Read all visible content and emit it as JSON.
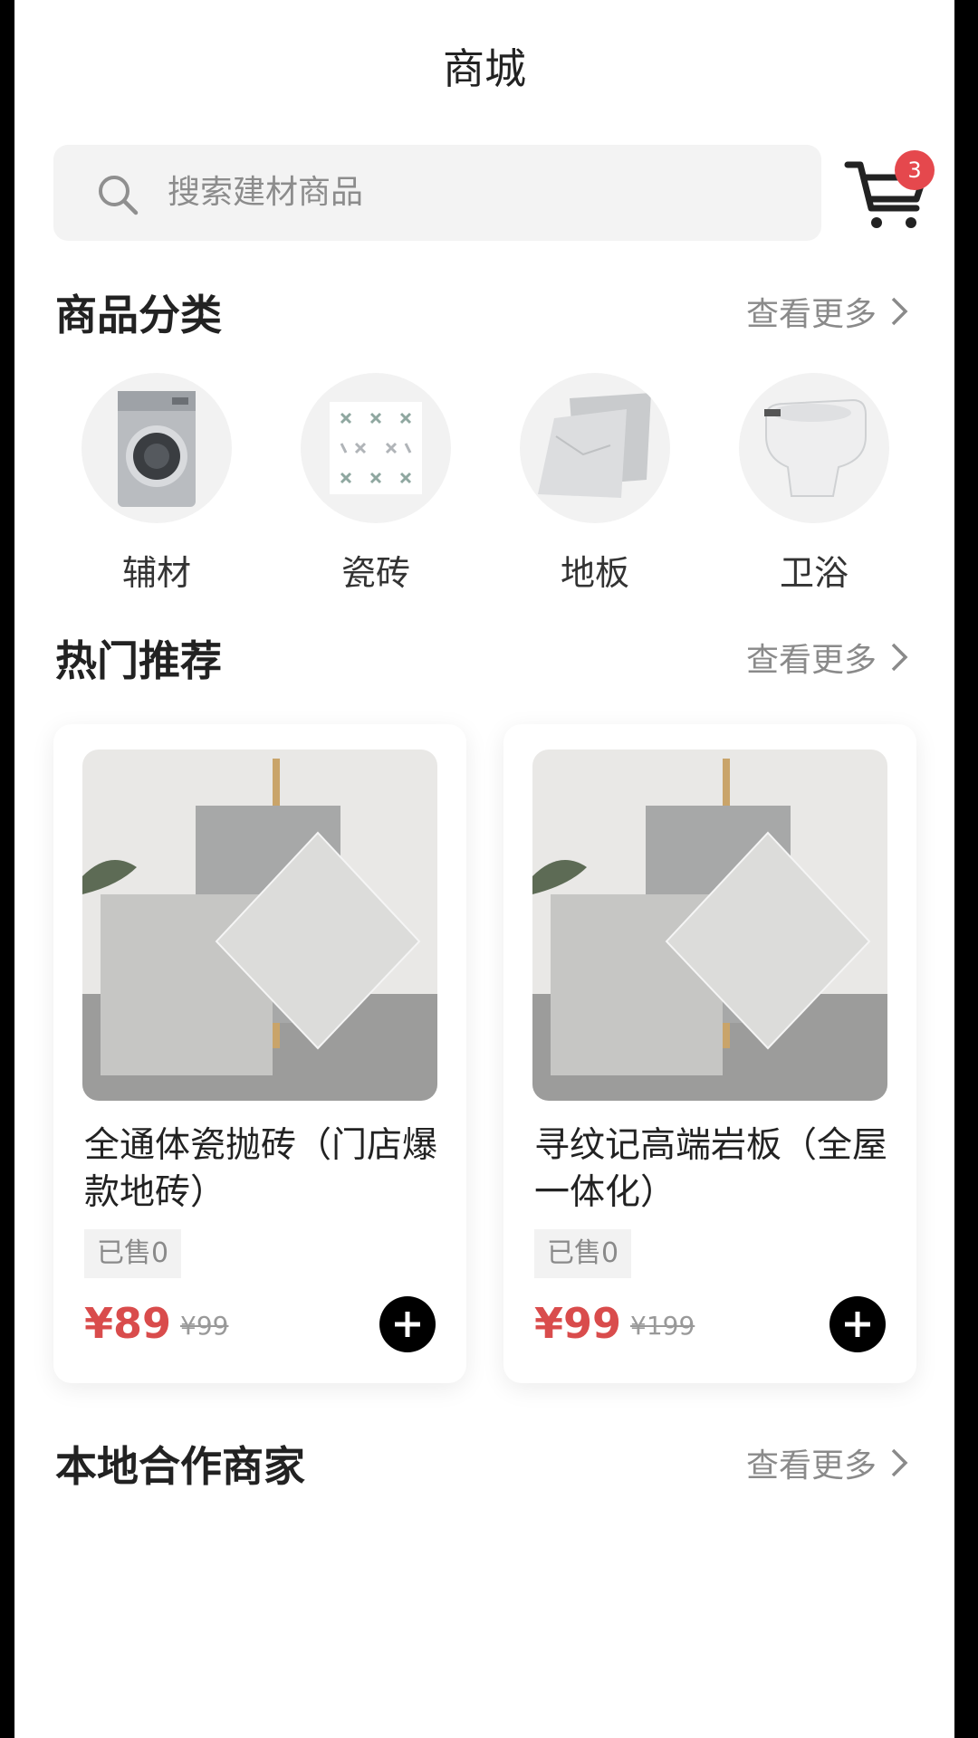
{
  "header": {
    "title": "商城"
  },
  "search": {
    "placeholder": "搜索建材商品"
  },
  "cart": {
    "badge_count": "3"
  },
  "sections": {
    "categories": {
      "title": "商品分类",
      "more": "查看更多"
    },
    "hot": {
      "title": "热门推荐",
      "more": "查看更多"
    },
    "merchants": {
      "title": "本地合作商家",
      "more": "查看更多"
    }
  },
  "categories": [
    {
      "label": "辅材",
      "icon": "washing-machine"
    },
    {
      "label": "瓷砖",
      "icon": "patterned-tile"
    },
    {
      "label": "地板",
      "icon": "floor-slabs"
    },
    {
      "label": "卫浴",
      "icon": "smart-toilet"
    }
  ],
  "products": [
    {
      "name": "全通体瓷抛砖（门店爆款地砖）",
      "sold": "已售0",
      "price": "¥89",
      "original_price": "¥99"
    },
    {
      "name": "寻纹记高端岩板（全屋一体化）",
      "sold": "已售0",
      "price": "¥99",
      "original_price": "¥199"
    }
  ],
  "colors": {
    "price": "#d94c4c",
    "badge": "#e5484d",
    "search_bg": "#f3f3f3"
  }
}
